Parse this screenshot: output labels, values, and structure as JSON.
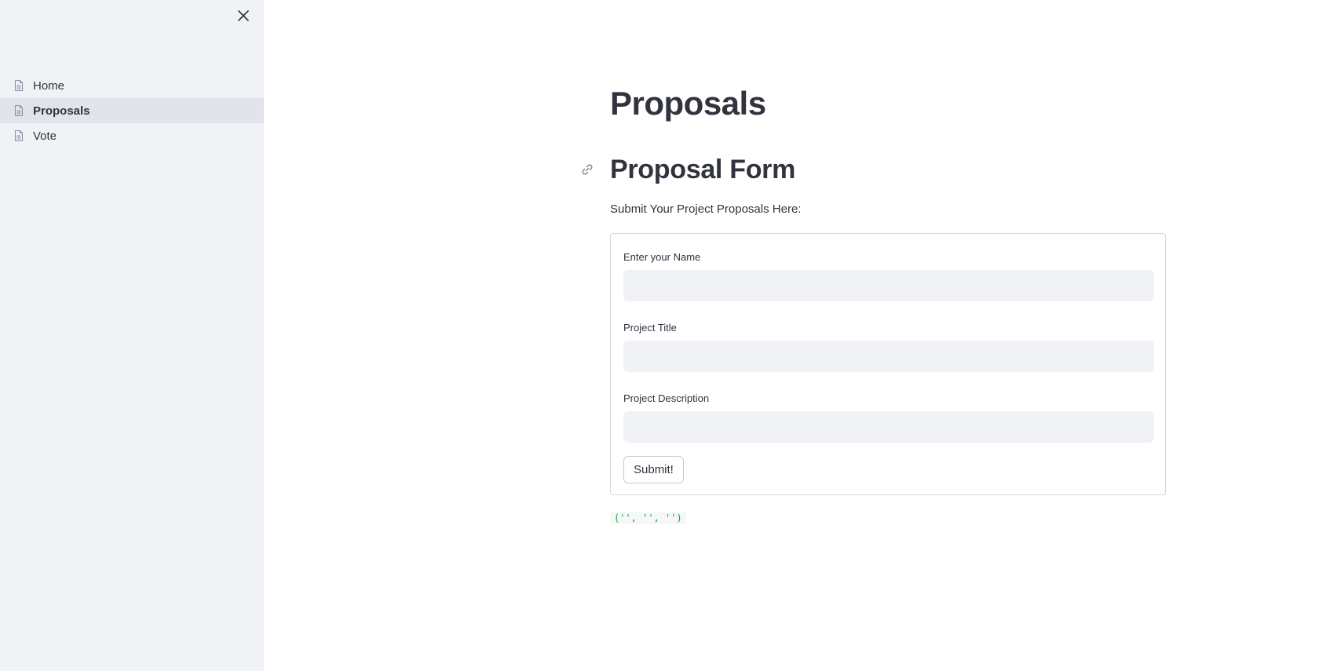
{
  "sidebar": {
    "close_icon": "close-icon",
    "items": [
      {
        "label": "Home",
        "icon": "document-icon",
        "active": false
      },
      {
        "label": "Proposals",
        "icon": "document-icon",
        "active": true
      },
      {
        "label": "Vote",
        "icon": "document-icon",
        "active": false
      }
    ]
  },
  "main": {
    "title": "Proposals",
    "form_heading": "Proposal Form",
    "anchor_icon": "link-icon",
    "subtitle": "Submit Your Project Proposals Here:",
    "form": {
      "fields": [
        {
          "label": "Enter your Name",
          "value": "",
          "placeholder": ""
        },
        {
          "label": "Project Title",
          "value": "",
          "placeholder": ""
        },
        {
          "label": "Project Description",
          "value": "",
          "placeholder": ""
        }
      ],
      "submit_label": "Submit!"
    },
    "output": "('', '', '')"
  },
  "colors": {
    "sidebar_bg": "#f0f2f6",
    "active_item_bg": "#e1e4ea",
    "text": "#31333f",
    "input_bg": "#f0f2f6",
    "code_text": "#09ab3b"
  }
}
